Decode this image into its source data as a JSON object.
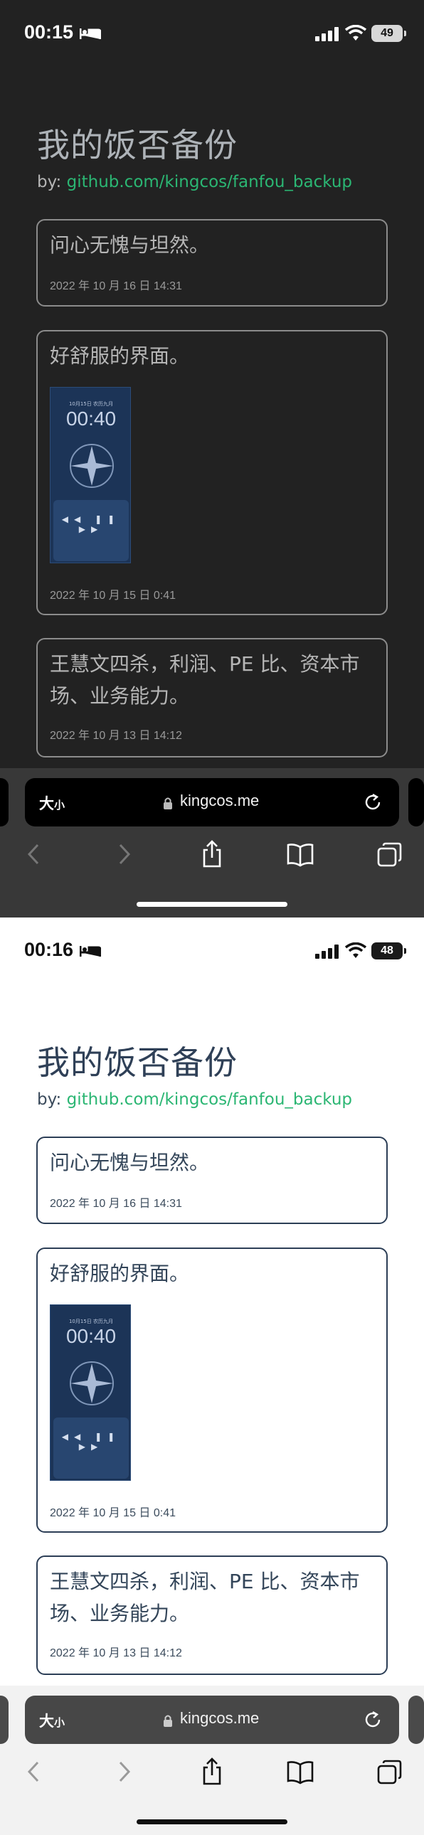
{
  "screens": [
    {
      "theme": "dark",
      "status": {
        "time": "00:15",
        "battery": "49"
      },
      "title": "我的饭否备份",
      "byline_prefix": "by: ",
      "byline_link": "github.com/kingcos/fanfou_backup",
      "posts": [
        {
          "text": "问心无愧与坦然。",
          "date": "2022 年 10 月 16 日 14:31"
        },
        {
          "text": "好舒服的界面。",
          "date": "2022 年 10 月 15 日 0:41",
          "image_time": "00:40",
          "image_date": "10月15日 农历九月"
        },
        {
          "text": "王慧文四杀，利润、PE 比、资本市场、业务能力。",
          "date": "2022 年 10 月 13 日 14:12"
        }
      ],
      "browser": {
        "aa_label_big": "大",
        "aa_label_small": "小",
        "url": "kingcos.me"
      }
    },
    {
      "theme": "light",
      "status": {
        "time": "00:16",
        "battery": "48"
      },
      "title": "我的饭否备份",
      "byline_prefix": "by: ",
      "byline_link": "github.com/kingcos/fanfou_backup",
      "posts": [
        {
          "text": "问心无愧与坦然。",
          "date": "2022 年 10 月 16 日 14:31"
        },
        {
          "text": "好舒服的界面。",
          "date": "2022 年 10 月 15 日 0:41",
          "image_time": "00:40",
          "image_date": "10月15日 农历九月"
        },
        {
          "text": "王慧文四杀，利润、PE 比、资本市场、业务能力。",
          "date": "2022 年 10 月 13 日 14:12"
        }
      ],
      "browser": {
        "aa_label_big": "大",
        "aa_label_small": "小",
        "url": "kingcos.me"
      }
    }
  ],
  "colors": {
    "link": "#2bb673",
    "dark_bg": "#222222",
    "light_bg": "#ffffff"
  },
  "icons": [
    "sleep-icon",
    "signal-icon",
    "wifi-icon",
    "lock-icon",
    "reload-icon",
    "back-icon",
    "forward-icon",
    "share-icon",
    "bookmarks-icon",
    "tabs-icon"
  ]
}
